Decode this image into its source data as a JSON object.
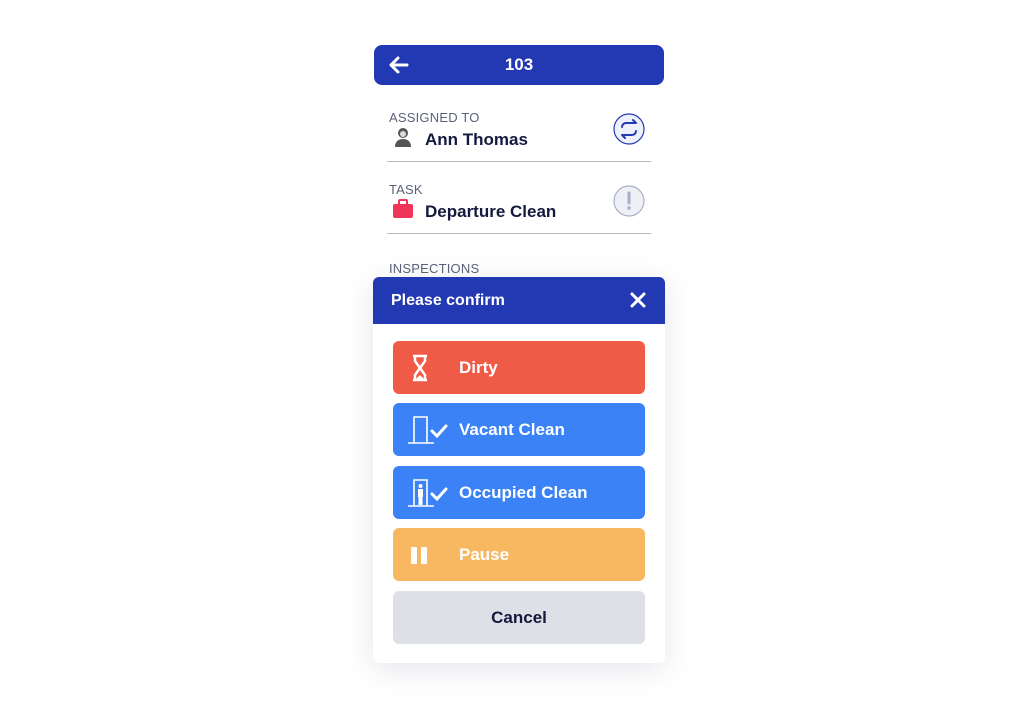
{
  "header": {
    "title": "103",
    "back_icon": "arrow-left-icon"
  },
  "assigned": {
    "label": "ASSIGNED TO",
    "value": "Ann Thomas",
    "icon": "housekeeper-icon",
    "action_icon": "swap-icon"
  },
  "task": {
    "label": "TASK",
    "value": "Departure Clean",
    "icon": "suitcase-icon",
    "action_icon": "exclamation-icon"
  },
  "inspections": {
    "label": "INSPECTIONS"
  },
  "modal": {
    "title": "Please confirm",
    "close_icon": "close-icon",
    "buttons": [
      {
        "label": "Dirty",
        "color": "#ef5b47",
        "icon": "hourglass-icon"
      },
      {
        "label": "Vacant Clean",
        "color": "#3b82f6",
        "icon": "door-check-icon"
      },
      {
        "label": "Occupied Clean",
        "color": "#3b82f6",
        "icon": "person-door-check-icon"
      },
      {
        "label": "Pause",
        "color": "#f8b862",
        "icon": "pause-icon"
      },
      {
        "label": "Cancel",
        "color": "#dde1e7"
      }
    ]
  }
}
